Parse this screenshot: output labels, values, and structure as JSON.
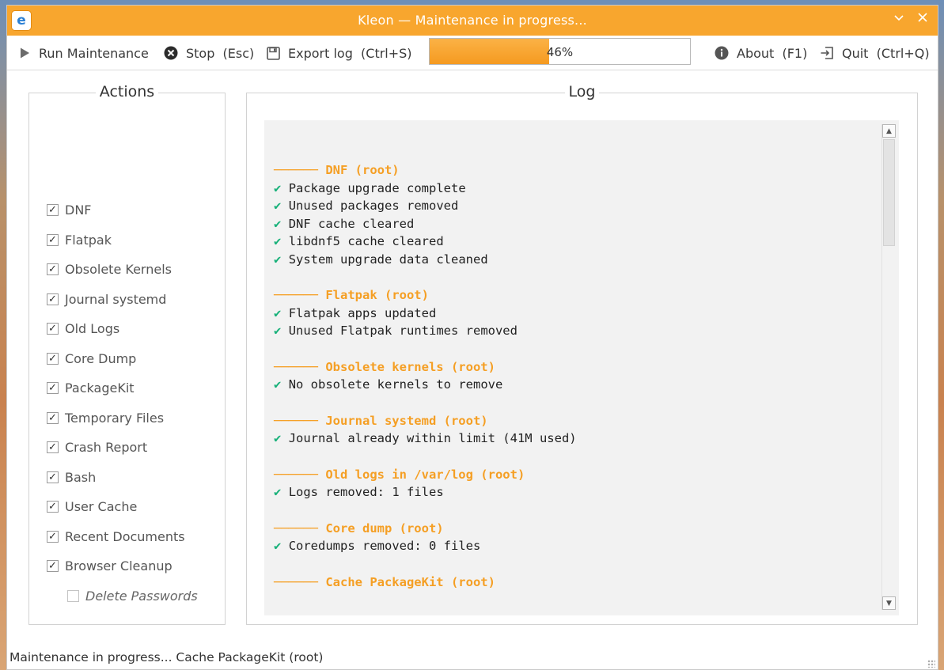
{
  "window": {
    "title": "Kleon — Maintenance in progress...",
    "app_icon": "e"
  },
  "toolbar": {
    "run_label": "Run Maintenance",
    "stop_label": "Stop",
    "stop_shortcut": "(Esc)",
    "export_label": "Export log",
    "export_shortcut": "(Ctrl+S)",
    "progress_percent": 46,
    "progress_text": "46%",
    "about_label": "About",
    "about_shortcut": "(F1)",
    "quit_label": "Quit",
    "quit_shortcut": "(Ctrl+Q)"
  },
  "actions": {
    "title": "Actions",
    "items": [
      {
        "label": "DNF",
        "checked": true
      },
      {
        "label": "Flatpak",
        "checked": true
      },
      {
        "label": "Obsolete Kernels",
        "checked": true
      },
      {
        "label": "Journal systemd",
        "checked": true
      },
      {
        "label": "Old Logs",
        "checked": true
      },
      {
        "label": "Core Dump",
        "checked": true
      },
      {
        "label": "PackageKit",
        "checked": true
      },
      {
        "label": "Temporary Files",
        "checked": true
      },
      {
        "label": "Crash Report",
        "checked": true
      },
      {
        "label": "Bash",
        "checked": true
      },
      {
        "label": "User Cache",
        "checked": true
      },
      {
        "label": "Recent Documents",
        "checked": true
      },
      {
        "label": "Browser Cleanup",
        "checked": true
      }
    ],
    "sub_item": {
      "label": "Delete Passwords",
      "checked": false
    },
    "check_mark": "✓"
  },
  "log": {
    "title": "Log",
    "sections": [
      {
        "header": "────── DNF (root)",
        "lines": [
          "Package upgrade complete",
          "Unused packages removed",
          "DNF cache cleared",
          "libdnf5 cache cleared",
          "System upgrade data cleaned"
        ]
      },
      {
        "header": "────── Flatpak (root)",
        "lines": [
          "Flatpak apps updated",
          "Unused Flatpak runtimes removed"
        ]
      },
      {
        "header": "────── Obsolete kernels (root)",
        "lines": [
          "No obsolete kernels to remove"
        ]
      },
      {
        "header": "────── Journal systemd (root)",
        "lines": [
          "Journal already within limit (41M used)"
        ]
      },
      {
        "header": "────── Old logs in /var/log (root)",
        "lines": [
          "Logs removed: 1 files"
        ]
      },
      {
        "header": "────── Core dump (root)",
        "lines": [
          "Coredumps removed: 0 files"
        ]
      },
      {
        "header": "────── Cache PackageKit (root)",
        "lines": []
      }
    ],
    "ok_mark": "✔"
  },
  "status": {
    "text": "Maintenance in progress...  Cache PackageKit (root)"
  },
  "colors": {
    "accent": "#f8a62e",
    "log_header": "#f59f24",
    "log_ok": "#19b17a"
  }
}
